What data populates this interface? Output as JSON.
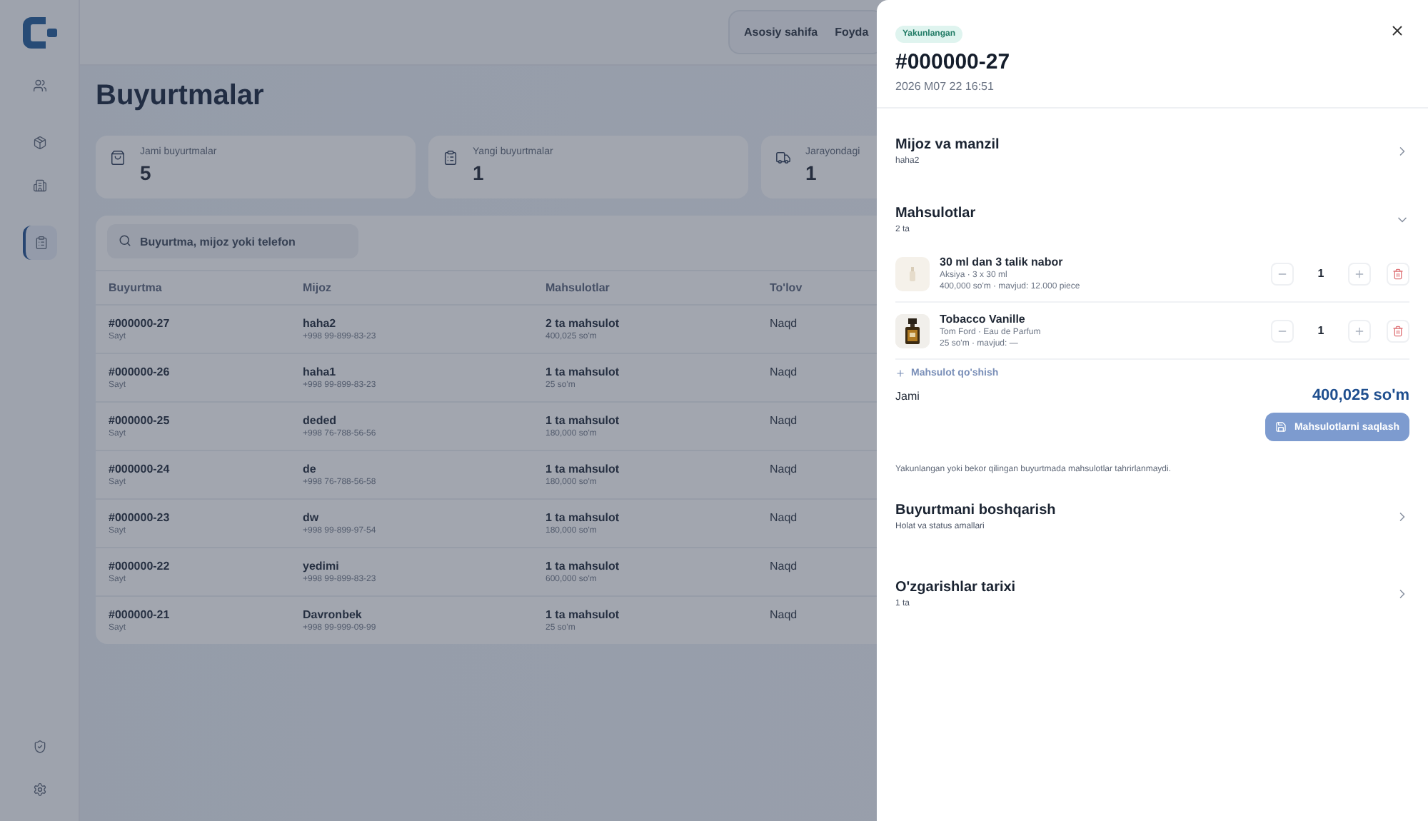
{
  "sidebar": {
    "items": [
      {
        "selected": false
      },
      {
        "selected": false
      },
      {
        "selected": false
      },
      {
        "selected": true
      }
    ]
  },
  "header": {
    "nav": [
      "Asosiy sahifa",
      "Foyda"
    ]
  },
  "page": {
    "title": "Buyurtmalar",
    "stats": [
      {
        "label": "Jami buyurtmalar",
        "value": "5"
      },
      {
        "label": "Yangi buyurtmalar",
        "value": "1"
      },
      {
        "label": "Jarayondagi",
        "value": "1"
      }
    ],
    "search": {
      "placeholder": "Buyurtma, mijoz yoki telefon"
    },
    "table": {
      "columns": [
        "Buyurtma",
        "Mijoz",
        "Mahsulotlar",
        "To'lov"
      ],
      "rows": [
        {
          "order": "#000000-27",
          "source": "Sayt",
          "customer": "haha2",
          "phone": "+998 99-899-83-23",
          "items": "2 ta mahsulot",
          "total": "400,025 so'm",
          "payment": "Naqd"
        },
        {
          "order": "#000000-26",
          "source": "Sayt",
          "customer": "haha1",
          "phone": "+998 99-899-83-23",
          "items": "1 ta mahsulot",
          "total": "25 so'm",
          "payment": "Naqd"
        },
        {
          "order": "#000000-25",
          "source": "Sayt",
          "customer": "deded",
          "phone": "+998 76-788-56-56",
          "items": "1 ta mahsulot",
          "total": "180,000 so'm",
          "payment": "Naqd"
        },
        {
          "order": "#000000-24",
          "source": "Sayt",
          "customer": "de",
          "phone": "+998 76-788-56-58",
          "items": "1 ta mahsulot",
          "total": "180,000 so'm",
          "payment": "Naqd"
        },
        {
          "order": "#000000-23",
          "source": "Sayt",
          "customer": "dw",
          "phone": "+998 99-899-97-54",
          "items": "1 ta mahsulot",
          "total": "180,000 so'm",
          "payment": "Naqd"
        },
        {
          "order": "#000000-22",
          "source": "Sayt",
          "customer": "yedimi",
          "phone": "+998 99-899-83-23",
          "items": "1 ta mahsulot",
          "total": "600,000 so'm",
          "payment": "Naqd"
        },
        {
          "order": "#000000-21",
          "source": "Sayt",
          "customer": "Davronbek",
          "phone": "+998 99-999-09-99",
          "items": "1 ta mahsulot",
          "total": "25 so'm",
          "payment": "Naqd"
        }
      ]
    }
  },
  "drawer": {
    "status": "Yakunlangan",
    "title": "#000000-27",
    "date": "2026 M07 22 16:51",
    "sections": [
      {
        "kind": "link",
        "title": "Mijoz va manzil",
        "subtitle": "haha2",
        "expanded": false
      },
      {
        "kind": "products",
        "title": "Mahsulotlar",
        "subtitle": "2 ta",
        "expanded": true,
        "products": [
          {
            "kind": "placeholder",
            "name": "30 ml dan 3 talik nabor",
            "meta": "Aksiya · 3 x 30 ml",
            "price": "400,000 so'm · mavjud: 12.000 piece",
            "qty": "1"
          },
          {
            "name": "Tobacco Vanille",
            "meta": "Tom Ford · Eau de Parfum",
            "price": "25 so'm · mavjud: —",
            "qty": "1"
          }
        ],
        "add_label": "Mahsulot qo'shish",
        "total_label": "Jami",
        "total": "400,025 so'm",
        "save": {
          "label": "Mahsulotlarni saqlash",
          "disabled": true
        },
        "note": "Yakunlangan yoki bekor qilingan buyurtmada mahsulotlar tahrirlanmaydi."
      },
      {
        "kind": "link",
        "title": "Buyurtmani boshqarish",
        "subtitle": "Holat va status amallari",
        "expanded": false
      },
      {
        "kind": "link",
        "title": "O'zgarishlar tarixi",
        "subtitle": "1 ta",
        "expanded": false
      }
    ]
  }
}
